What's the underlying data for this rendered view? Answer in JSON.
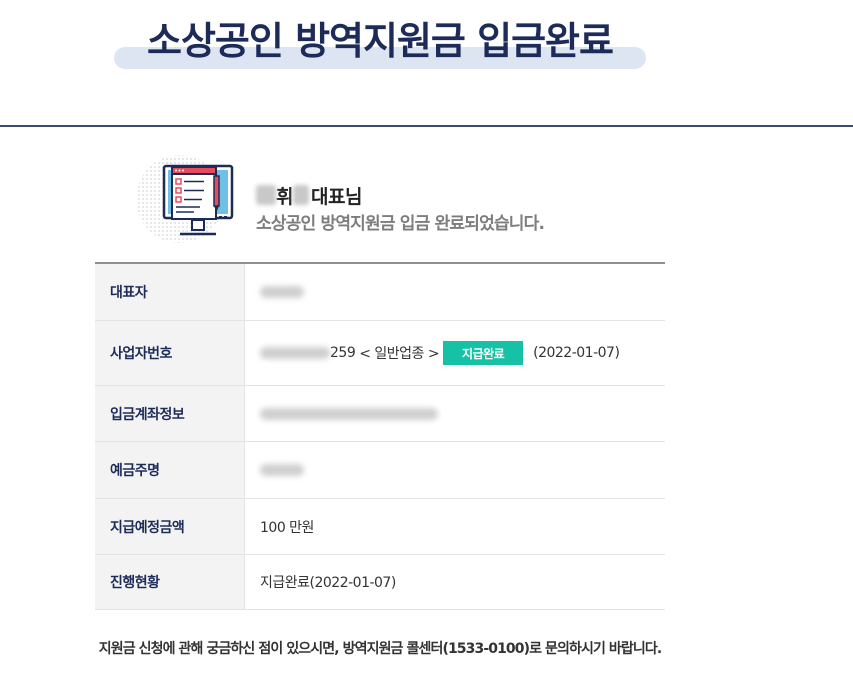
{
  "page": {
    "title": "소상공인 방역지원금 입금완료"
  },
  "greeting": {
    "name_middle": "휘",
    "honorific": "대표님",
    "message": "소상공인 방역지원금 입금 완료되었습니다."
  },
  "table": {
    "rows": [
      {
        "label": "대표자",
        "value": ""
      },
      {
        "label": "사업자번호",
        "number_suffix": "259",
        "business_type": "< 일반업종 >",
        "status_badge": "지급완료",
        "status_date": "(2022-01-07)"
      },
      {
        "label": "입금계좌정보",
        "value": ""
      },
      {
        "label": "예금주명",
        "value": ""
      },
      {
        "label": "지급예정금액",
        "value": "100 만원"
      },
      {
        "label": "진행현황",
        "value": "지급완료(2022-01-07)"
      }
    ]
  },
  "footer": {
    "note": "지원금 신청에 관해 궁금하신 점이 있으시면, 방역지원금 콜센터(1533-0100)로 문의하시기 바랍니다."
  },
  "colors": {
    "title": "#1d2b59",
    "title_highlight": "#dde4f2",
    "badge": "#17c1a5",
    "label": "#1d2b59"
  },
  "icons": [
    "monitor-checklist-icon"
  ]
}
